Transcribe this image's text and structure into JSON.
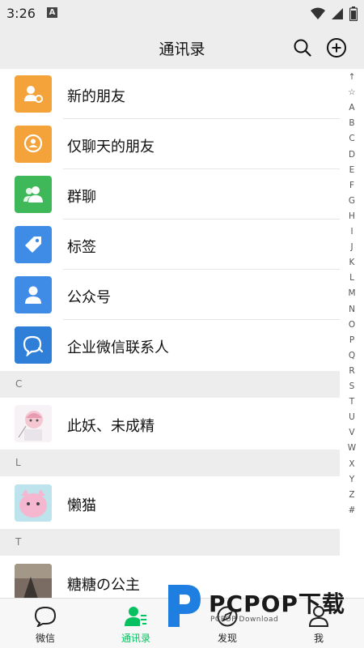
{
  "status_bar": {
    "time": "3:26",
    "notification_glyph": "A",
    "icons": [
      "wifi-icon",
      "signal-icon",
      "battery-icon"
    ]
  },
  "header": {
    "title": "通讯录",
    "icons": [
      "search-icon",
      "add-circle-icon"
    ]
  },
  "features": [
    {
      "label": "新的朋友",
      "icon": "new-friend-icon",
      "color": "#f3a33a"
    },
    {
      "label": "仅聊天的朋友",
      "icon": "chat-only-friend-icon",
      "color": "#f3a33a"
    },
    {
      "label": "群聊",
      "icon": "group-chat-icon",
      "color": "#3fb859"
    },
    {
      "label": "标签",
      "icon": "tag-icon",
      "color": "#3f8ce6"
    },
    {
      "label": "公众号",
      "icon": "official-account-icon",
      "color": "#3f8ce6"
    },
    {
      "label": "企业微信联系人",
      "icon": "work-contact-icon",
      "color": "#2f7fd8"
    }
  ],
  "sections": [
    {
      "letter": "C",
      "contacts": [
        {
          "name": "此妖、未成精",
          "avatar": "anime-avatar"
        }
      ]
    },
    {
      "letter": "L",
      "contacts": [
        {
          "name": "懒猫",
          "avatar": "cat-avatar"
        }
      ]
    },
    {
      "letter": "T",
      "contacts": [
        {
          "name": "糖糖の公主",
          "avatar": "photo-avatar"
        }
      ]
    }
  ],
  "index_letters": [
    "↑",
    "☆",
    "A",
    "B",
    "C",
    "D",
    "E",
    "F",
    "G",
    "H",
    "I",
    "J",
    "K",
    "L",
    "M",
    "N",
    "O",
    "P",
    "Q",
    "R",
    "S",
    "T",
    "U",
    "V",
    "W",
    "X",
    "Y",
    "Z",
    "#"
  ],
  "tabs": [
    {
      "label": "微信",
      "icon": "chat-bubble-icon",
      "active": false
    },
    {
      "label": "通讯录",
      "icon": "contacts-icon",
      "active": true
    },
    {
      "label": "发现",
      "icon": "discover-compass-icon",
      "active": false
    },
    {
      "label": "我",
      "icon": "me-person-icon",
      "active": false
    }
  ],
  "watermark": {
    "brand": "PCPOP下载",
    "sub": "PCPOP Download"
  },
  "colors": {
    "accent": "#07c160",
    "header_bg": "#ededed"
  }
}
